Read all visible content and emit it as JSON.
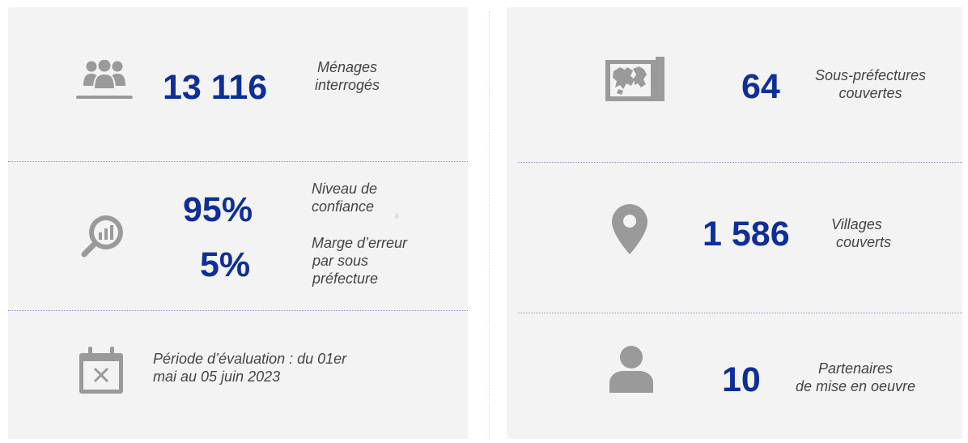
{
  "colors": {
    "accent": "#0f2f98",
    "icon": "#9a9a9a",
    "panel_background": "#f3f3f3",
    "divider": "#8f96bf",
    "text": "#444444"
  },
  "left_panel": {
    "households": {
      "icon": "people-group-icon",
      "value": "13 116",
      "label_line1": "Ménages",
      "label_line2": "interrogés"
    },
    "confidence": {
      "icon": "magnifier-chart-icon",
      "confidence_value": "95%",
      "margin_value": "5%",
      "confidence_label_line1": "Niveau de",
      "confidence_label_line2": "confiance",
      "margin_label_line1": "Marge d’erreur",
      "margin_label_line2": "par sous",
      "margin_label_line3": "préfecture",
      "stray_mark": "k"
    },
    "period": {
      "icon": "calendar-cross-icon",
      "text_line1": "Période d’évaluation : du 01er",
      "text_line2": "mai au 05 juin 2023"
    }
  },
  "right_panel": {
    "subprefectures": {
      "icon": "map-icon",
      "value": "64",
      "label_line1": "Sous-préfectures",
      "label_line2": "couvertes"
    },
    "villages": {
      "icon": "location-pin-icon",
      "value": "1 586",
      "label_line1": "Villages",
      "label_line2": "couverts"
    },
    "partners": {
      "icon": "person-icon",
      "value": "10",
      "label_line1": "Partenaires",
      "label_line2": "de mise en oeuvre"
    }
  }
}
